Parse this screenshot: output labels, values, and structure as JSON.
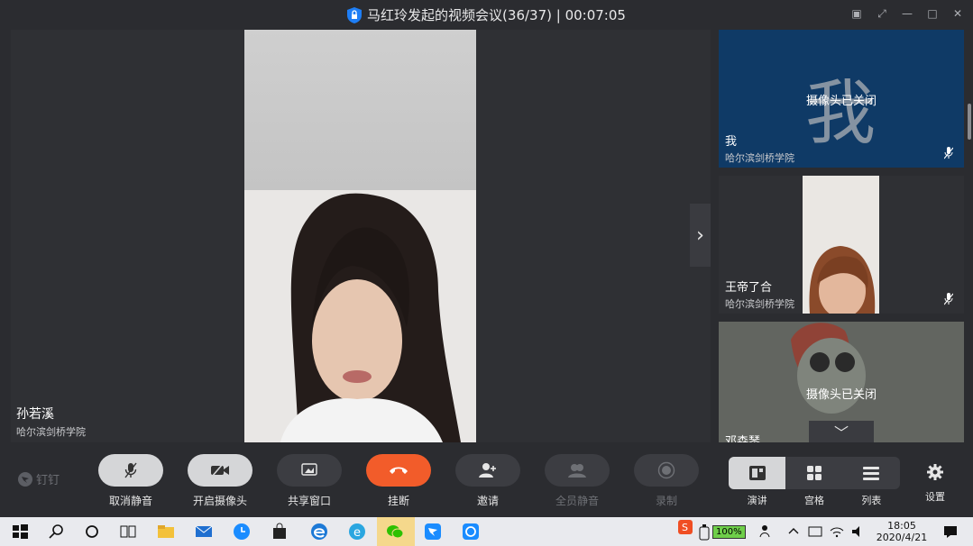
{
  "window": {
    "title": "马红玲发起的视频会议(36/37) | 00:07:05"
  },
  "main": {
    "speaker_name": "孙若溪",
    "speaker_org": "哈尔滨剑桥学院"
  },
  "sidebar": {
    "tiles": [
      {
        "big_char": "我",
        "camera_status": "摄像头已关闭",
        "name": "我",
        "org": "哈尔滨剑桥学院"
      },
      {
        "name": "王帝了合",
        "org": "哈尔滨剑桥学院"
      },
      {
        "camera_status": "摄像头已关闭",
        "name": "邓森琴"
      }
    ]
  },
  "toolbar": {
    "app_logo": "钉钉",
    "buttons": [
      {
        "label": "取消静音"
      },
      {
        "label": "开启摄像头"
      },
      {
        "label": "共享窗口"
      },
      {
        "label": "挂断"
      },
      {
        "label": "邀请"
      },
      {
        "label": "全员静音"
      },
      {
        "label": "录制"
      }
    ],
    "layout_labels": [
      "演讲",
      "宫格",
      "列表"
    ],
    "settings_label": "设置"
  },
  "taskbar": {
    "battery": "100%",
    "time": "18:05",
    "date": "2020/4/21"
  },
  "colors": {
    "hangup": "#f25c2a",
    "me_tile": "#0f3a66",
    "background": "#2b2c30"
  }
}
